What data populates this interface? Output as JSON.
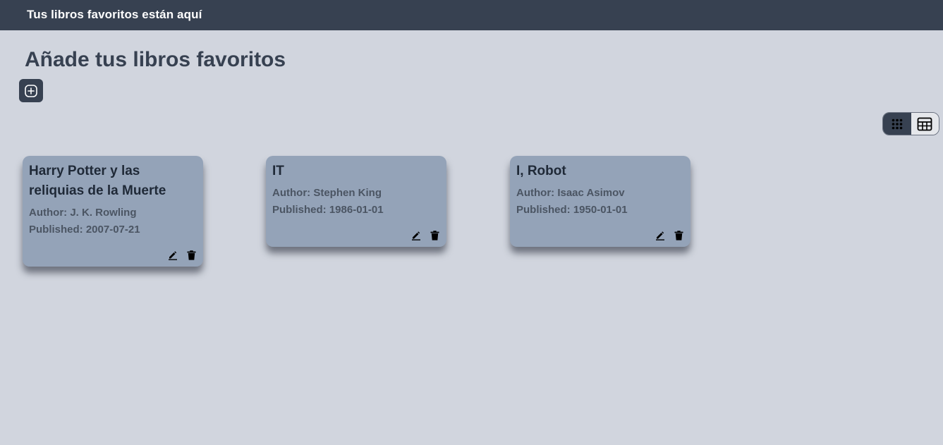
{
  "header": {
    "title": "Tus libros favoritos están aquí"
  },
  "main": {
    "title": "Añade tus libros favoritos",
    "add_icon": "plus-circle-icon"
  },
  "view_toggle": {
    "active": "grid",
    "options": [
      {
        "id": "grid",
        "icon": "grid-dots-icon"
      },
      {
        "id": "table",
        "icon": "table-icon"
      }
    ]
  },
  "books": [
    {
      "title": "Harry Potter y las reliquias de la Muerte",
      "author": "Author: J. K. Rowling",
      "published": "Published: 2007-07-21"
    },
    {
      "title": "IT",
      "author": "Author: Stephen King",
      "published": "Published: 1986-01-01"
    },
    {
      "title": "I, Robot",
      "author": "Author: Isaac Asimov",
      "published": "Published: 1950-01-01"
    }
  ],
  "card_actions": {
    "edit_icon": "pencil-icon",
    "delete_icon": "trash-icon"
  },
  "colors": {
    "topbar": "#374151",
    "background": "#d1d5de",
    "card": "#94a3b8",
    "text": "#374151"
  }
}
